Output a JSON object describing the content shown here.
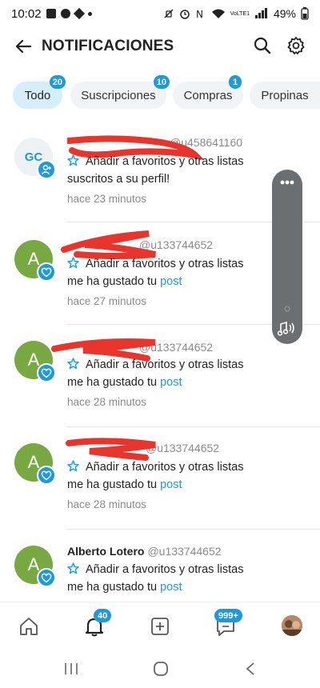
{
  "status_bar": {
    "time": "10:02",
    "battery": "49%",
    "network": "VoLTE1"
  },
  "header": {
    "title": "NOTIFICACIONES"
  },
  "tabs": [
    {
      "label": "Todo",
      "badge": "20",
      "active": true
    },
    {
      "label": "Suscripciones",
      "badge": "10",
      "active": false
    },
    {
      "label": "Compras",
      "badge": "1",
      "active": false
    },
    {
      "label": "Propinas",
      "badge": "",
      "active": false
    }
  ],
  "notifications": [
    {
      "avatar": "GC",
      "avatar_color": "#eef1f3",
      "badge_icon": "person-add-icon",
      "name": "",
      "handle": "@u458641160",
      "fav_text": "Añadir a favoritos y otras listas",
      "message": "suscritos a su perfil!",
      "link": "",
      "time": "hace 23 minutos"
    },
    {
      "avatar": "A",
      "avatar_color": "#78a842",
      "badge_icon": "heart-icon",
      "name": "",
      "handle": "@u133744652",
      "fav_text": "Añadir a favoritos y otras listas",
      "message": "me ha gustado tu",
      "link": "post",
      "time": "hace 27 minutos"
    },
    {
      "avatar": "A",
      "avatar_color": "#78a842",
      "badge_icon": "heart-icon",
      "name": "",
      "handle": "@u133744652",
      "fav_text": "Añadir a favoritos y otras listas",
      "message": "me ha gustado tu",
      "link": "post",
      "time": "hace 28 minutos"
    },
    {
      "avatar": "A",
      "avatar_color": "#78a842",
      "badge_icon": "heart-icon",
      "name": "",
      "handle": "@u133744652",
      "fav_text": "Añadir a favoritos y otras listas",
      "message": "me ha gustado tu",
      "link": "post",
      "time": "hace 28 minutos"
    },
    {
      "avatar": "A",
      "avatar_color": "#78a842",
      "badge_icon": "heart-icon",
      "name": "Alberto Lotero",
      "handle": "@u133744652",
      "fav_text": "Añadir a favoritos y otras listas",
      "message": "me ha gustado tu",
      "link": "post",
      "time": ""
    }
  ],
  "bottom_nav": {
    "notifications_badge": "40",
    "messages_badge": "999+"
  },
  "colors": {
    "accent": "#1e9ad6",
    "avatar_green": "#78a842",
    "redaction": "#e8342a"
  }
}
